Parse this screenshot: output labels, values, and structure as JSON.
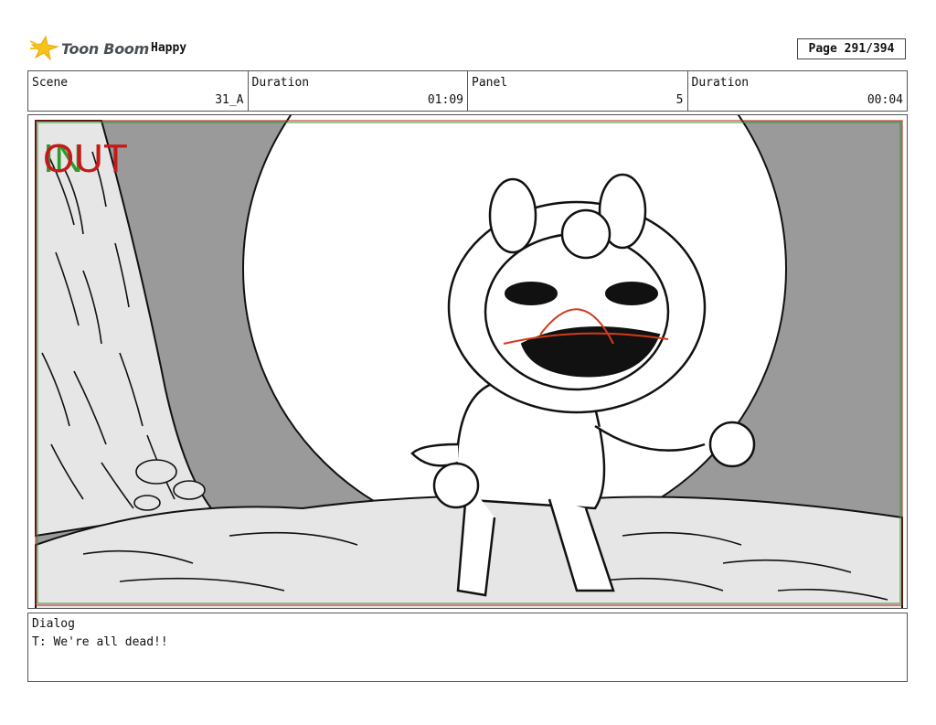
{
  "header": {
    "logo_text": "Toon Boom",
    "project": "Happy",
    "page": "Page 291/394"
  },
  "info": {
    "scene_label": "Scene",
    "scene_value": "31_A",
    "duration_label": "Duration",
    "duration_value": "01:09",
    "panel_label": "Panel",
    "panel_value": "5",
    "panel_duration_label": "Duration",
    "panel_duration_value": "00:04"
  },
  "panel": {
    "in_marker": "IN",
    "out_marker": "OUT",
    "in_color": "#2e9a2e",
    "out_color": "#c41a1a"
  },
  "dialog": {
    "label": "Dialog",
    "text": "T: We're all dead!!"
  }
}
